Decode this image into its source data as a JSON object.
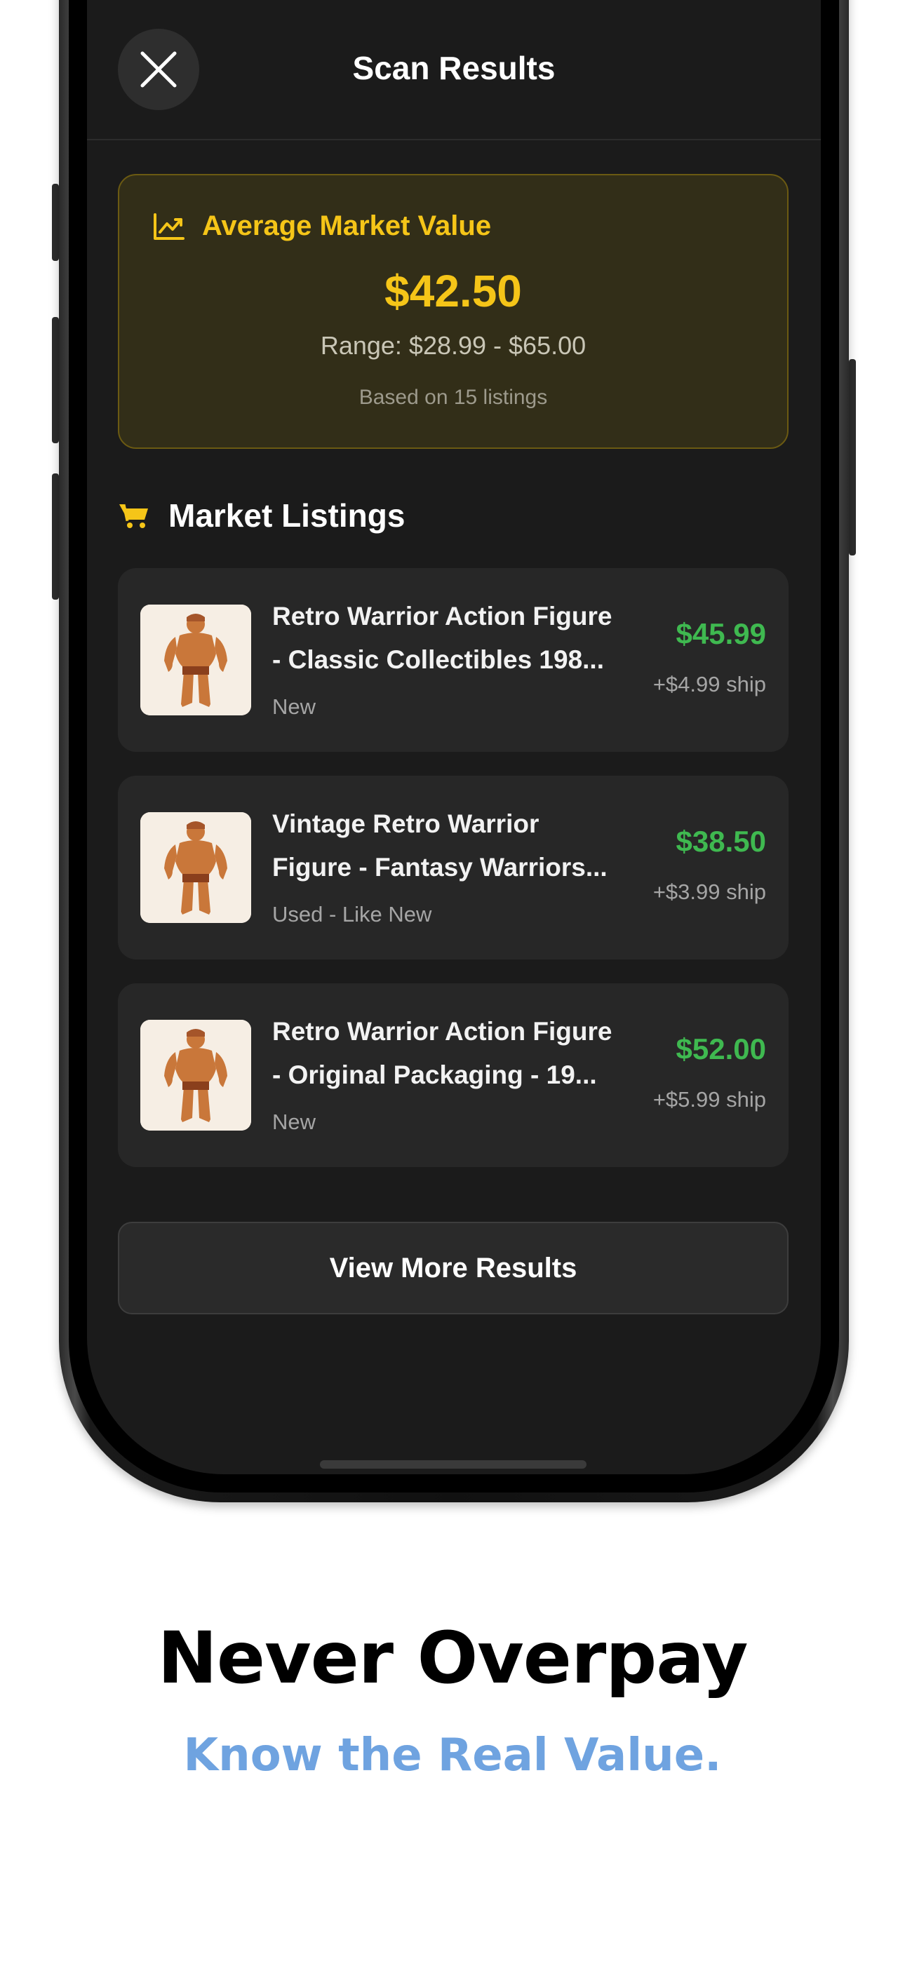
{
  "header": {
    "title": "Scan Results",
    "close_icon": "close-icon"
  },
  "average_card": {
    "label": "Average Market Value",
    "icon": "trend-chart-icon",
    "value": "$42.50",
    "range": "Range: $28.99 - $65.00",
    "based_on": "Based on 15 listings",
    "accent_color": "#f5c518"
  },
  "listings_section": {
    "title": "Market Listings",
    "icon": "cart-icon",
    "items": [
      {
        "title_line1": "Retro Warrior Action Figure",
        "title_line2": "- Classic Collectibles 198...",
        "condition": "New",
        "price": "$45.99",
        "shipping": "+$4.99 ship"
      },
      {
        "title_line1": "Vintage Retro Warrior",
        "title_line2": "Figure - Fantasy Warriors...",
        "condition": "Used - Like New",
        "price": "$38.50",
        "shipping": "+$3.99 ship"
      },
      {
        "title_line1": "Retro Warrior Action Figure",
        "title_line2": "- Original Packaging - 19...",
        "condition": "New",
        "price": "$52.00",
        "shipping": "+$5.99 ship"
      }
    ],
    "price_color": "#3fb950"
  },
  "view_more_label": "View More Results",
  "marketing": {
    "headline": "Never Overpay",
    "subheadline": "Know the Real Value.",
    "subheadline_color": "#6fa3e0"
  }
}
